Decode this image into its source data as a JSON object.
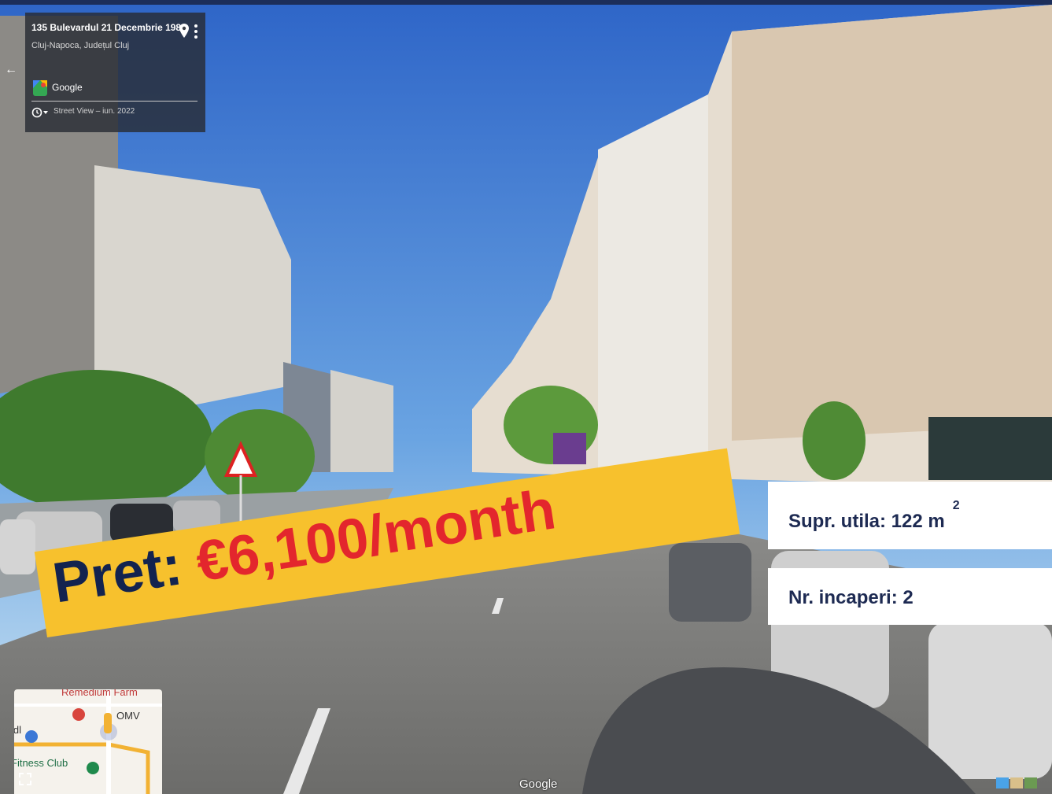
{
  "street_view": {
    "address": "135 Bulevardul 21 Decembrie 1989",
    "locality": "Cluj-Napoca, Județul Cluj",
    "provider": "Google",
    "date": "Street View – iun. 2022",
    "watermark": "Google"
  },
  "listing": {
    "price_label": "Pret:",
    "price_value": "€6,100/month",
    "area_text": "Supr. utila: 122 m",
    "area_superscript": "2",
    "rooms_text": "Nr. incaperi: 2"
  },
  "minimap": {
    "pois": [
      "Remedium Farm",
      "OMV",
      "Fitness Club",
      "idl"
    ]
  },
  "colors": {
    "banner": "#f7c12d",
    "price_label": "#13234f",
    "price_value": "#e3262d",
    "frame": "#1c2e5a"
  },
  "icons": [
    "location-pin-icon",
    "more-vert-icon",
    "google-maps-icon",
    "history-clock-icon",
    "back-arrow-icon",
    "expand-icon",
    "layers-icon"
  ]
}
